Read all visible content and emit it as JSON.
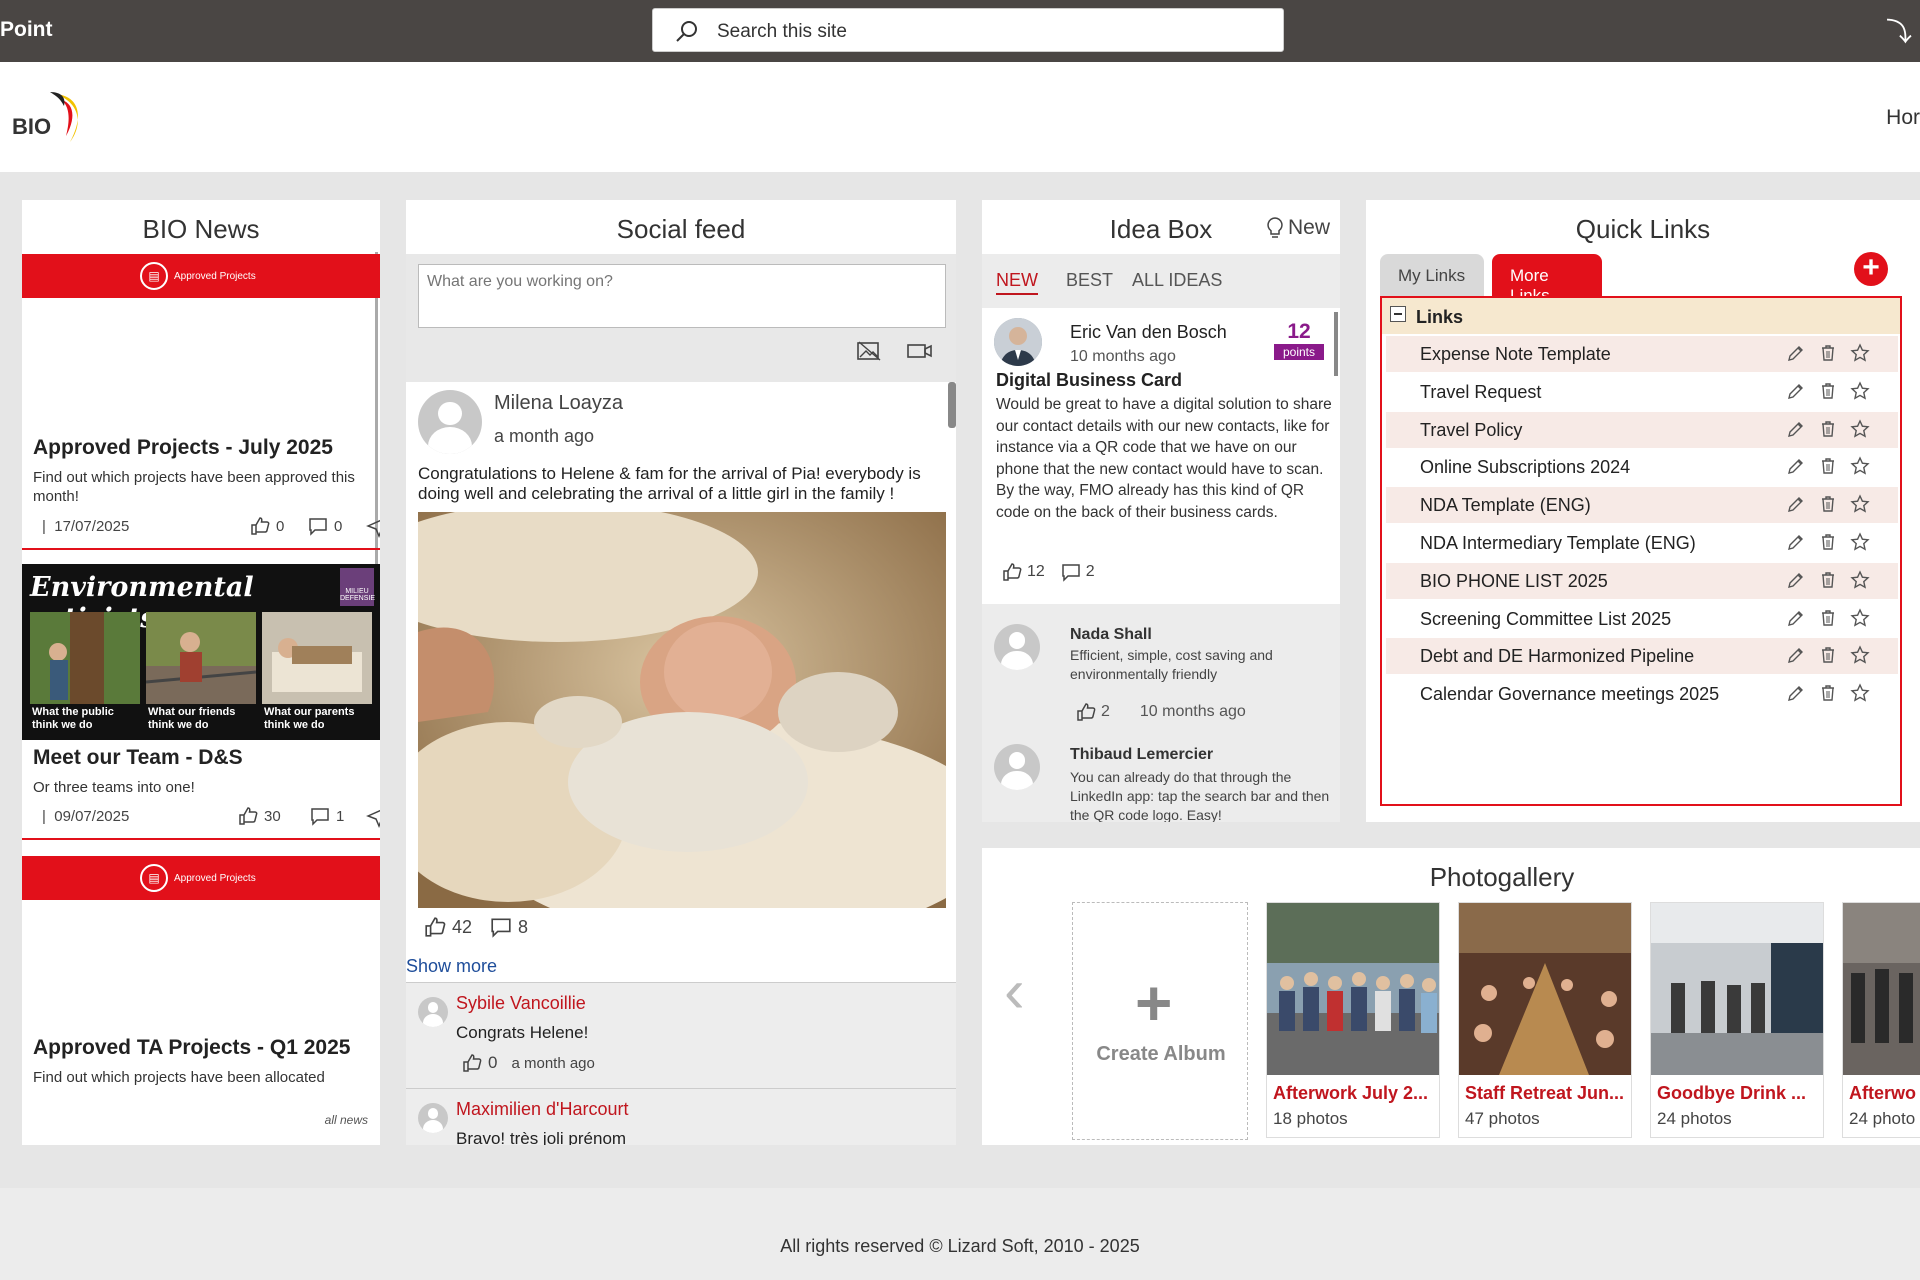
{
  "topbar": {
    "brand": "Point",
    "search_placeholder": "Search this site",
    "corner_glyph": "⤵"
  },
  "header": {
    "logo_text": "BIO",
    "nav_home": "Hor"
  },
  "news": {
    "title": "BIO News",
    "banner_label": "Approved Projects",
    "items": [
      {
        "title": "Approved Projects - July 2025",
        "desc": "Find out which projects have been approved this month!",
        "date": "17/07/2025",
        "likes": "0",
        "comments": "0"
      },
      {
        "title": "Meet our Team - D&S",
        "desc": "Or three teams into one!",
        "date": "09/07/2025",
        "likes": "30",
        "comments": "1",
        "image": {
          "headline": "Environmental activists",
          "badge": "MILIEU DEFENSIE",
          "captions": [
            "What the public think we do",
            "What our friends think we do",
            "What our parents think we do"
          ]
        }
      },
      {
        "title": "Approved TA Projects - Q1 2025",
        "desc": "Find out which projects have been allocated"
      }
    ],
    "all_news": "all news"
  },
  "social": {
    "title": "Social feed",
    "input_placeholder": "What are you working on?",
    "post": {
      "author": "Milena Loayza",
      "time": "a month ago",
      "text": "Congratulations to Helene & fam for the arrival of Pia! everybody is doing well and celebrating the arrival of a little girl in the family !",
      "likes": "42",
      "comments": "8"
    },
    "show_more": "Show more",
    "comments": [
      {
        "name": "Sybile Vancoillie",
        "text": "Congrats Helene!",
        "likes": "0",
        "time": "a month ago"
      },
      {
        "name": "Maximilien d'Harcourt",
        "text": "Bravo! très joli prénom"
      }
    ]
  },
  "idea": {
    "title": "Idea Box",
    "new_label": "New",
    "tabs": [
      "NEW",
      "BEST",
      "ALL IDEAS"
    ],
    "top": {
      "author": "Eric Van den Bosch",
      "time": "10 months ago",
      "points": "12",
      "points_label": "points",
      "title": "Digital Business Card",
      "text": "Would be great to have a digital solution to share our contact details with our new contacts, like for instance via a QR code that we have on our phone that the new contact would have to scan. By the way, FMO already has this kind of QR code on the back of their business cards.",
      "likes": "12",
      "comments": "2"
    },
    "replies": [
      {
        "name": "Nada Shall",
        "text": "Efficient, simple, cost saving and environmentally friendly",
        "likes": "2",
        "time": "10 months ago"
      },
      {
        "name": "Thibaud Lemercier",
        "text": "You can already do that through the LinkedIn app: tap the search bar and then the QR code logo. Easy!"
      }
    ]
  },
  "quick": {
    "title": "Quick Links",
    "tab_my": "My Links",
    "tab_more": "More Links",
    "add_glyph": "+",
    "group_title": "Links",
    "links": [
      "Expense Note Template",
      "Travel Request",
      "Travel Policy",
      "Online Subscriptions 2024",
      "NDA Template (ENG)",
      "NDA Intermediary Template (ENG)",
      "BIO PHONE LIST 2025",
      "Screening Committee List 2025",
      "Debt and DE Harmonized Pipeline",
      "Calendar Governance meetings 2025"
    ]
  },
  "gallery": {
    "title": "Photogallery",
    "create_label": "Create Album",
    "albums": [
      {
        "name": "Afterwork July 2...",
        "count": "18 photos"
      },
      {
        "name": "Staff Retreat Jun...",
        "count": "47 photos"
      },
      {
        "name": "Goodbye Drink ...",
        "count": "24 photos"
      },
      {
        "name": "Afterwo",
        "count": "24 photo"
      }
    ]
  },
  "footer": {
    "text": "All rights reserved © Lizard Soft, 2010 - 2025"
  },
  "colors": {
    "accent": "#e2101a",
    "link_red": "#c0161e",
    "topbar": "#4a4644",
    "points_purple": "#8a1a8a",
    "link_blue": "#1e4d9a"
  }
}
